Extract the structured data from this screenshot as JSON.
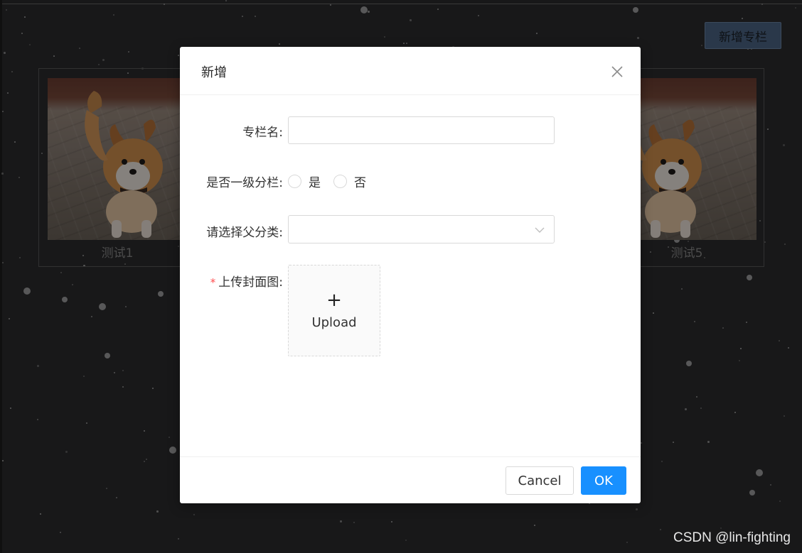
{
  "page": {
    "add_column_button": "新增专栏",
    "cards": [
      {
        "caption": "测试1"
      },
      {
        "caption": "测试5"
      }
    ]
  },
  "modal": {
    "title": "新增",
    "fields": {
      "column_name_label": "专栏名:",
      "column_name_value": "",
      "top_level_label": "是否一级分栏:",
      "radio_yes": "是",
      "radio_no": "否",
      "parent_category_label": "请选择父分类:",
      "parent_category_value": "",
      "cover_label": "上传封面图:",
      "cover_required_mark": "*",
      "upload_plus": "+",
      "upload_text": "Upload"
    },
    "footer": {
      "cancel_label": "Cancel",
      "ok_label": "OK"
    }
  },
  "watermark": "CSDN @lin-fighting",
  "colors": {
    "primary": "#1890ff",
    "required": "#ff4d4f",
    "background": "#2c2c2e"
  },
  "icons": [
    "close-icon",
    "chevron-down-icon",
    "plus-icon"
  ]
}
